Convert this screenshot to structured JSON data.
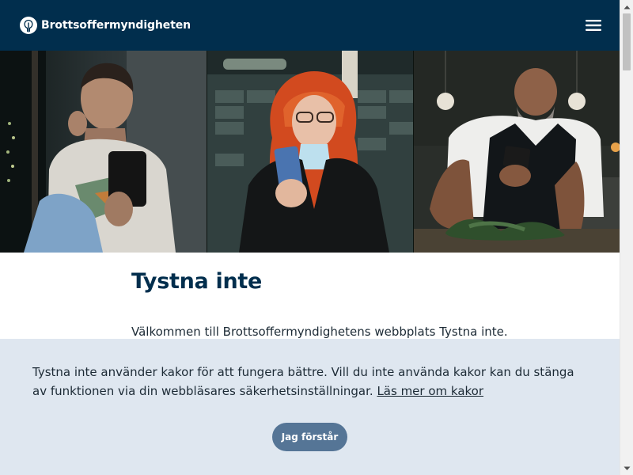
{
  "header": {
    "logo_text": "Brottsoffermyndigheten",
    "logo_icon": "brottsoffermyndigheten-logo-icon",
    "menu_icon": "hamburger-menu-icon"
  },
  "main": {
    "title": "Tystna inte",
    "intro": "Välkommen till Brottsoffermyndighetens webbplats Tystna inte."
  },
  "cookie_banner": {
    "text": "Tystna inte använder kakor för att fungera bättre. Vill du inte använda kakor kan du stänga av funktionen via din webbläsares säkerhetsinställningar.",
    "link_text": "Läs mer om kakor",
    "button_label": "Jag förstår"
  },
  "colors": {
    "header_bg": "#012e4d",
    "title": "#012e4d",
    "cookie_bg": "#dfe7f0",
    "cookie_button": "#557596"
  }
}
